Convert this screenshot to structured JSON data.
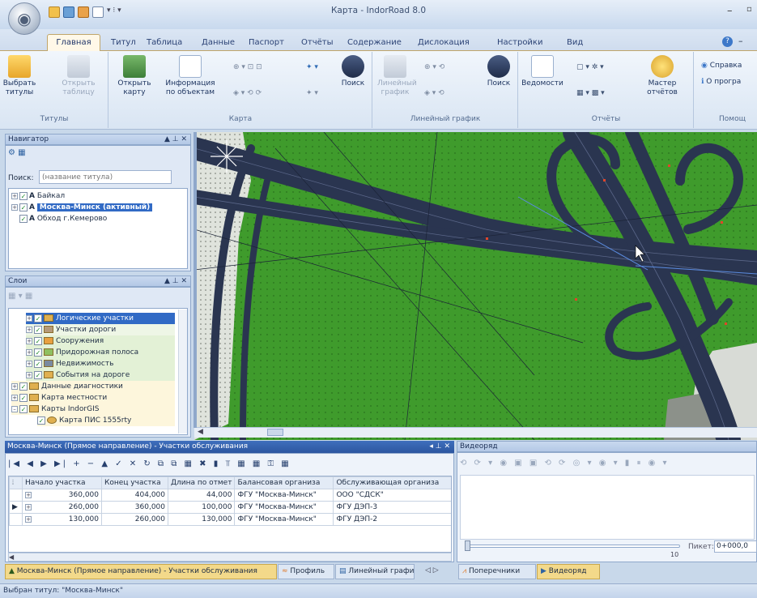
{
  "window": {
    "title": "Карта - IndorRoad 8.0"
  },
  "tabs": [
    "Главная",
    "Титул",
    "Таблица",
    "Данные",
    "Паспорт",
    "Отчёты",
    "Содержание",
    "Дислокация",
    "Настройки",
    "Вид"
  ],
  "ribbon": {
    "groups": {
      "titles": "Титулы",
      "map": "Карта",
      "linear": "Линейный график",
      "reports": "Отчёты",
      "help": "Помощ"
    },
    "select_titles": "Выбрать титулы",
    "open_table": "Открыть таблицу",
    "open_map": "Открыть карту",
    "object_info": "Информация по объектам",
    "search": "Поиск",
    "linear_graph": "Линейный график",
    "search2": "Поиск",
    "statements": "Ведомости",
    "report_master": "Мастер отчётов",
    "help_ref": "Справка",
    "about": "О програ"
  },
  "navigator": {
    "title": "Навигатор",
    "search_label": "Поиск:",
    "search_placeholder": "(название титула)",
    "items": [
      "Байкал",
      "Москва-Минск (активный)",
      "Обход г.Кемерово"
    ]
  },
  "layers": {
    "title": "Слои",
    "items": [
      "Логические участки",
      "Участки дороги",
      "Сооружения",
      "Придорожная полоса",
      "Недвижимость",
      "События на дороге",
      "Данные диагностики",
      "Карта местности",
      "Карты IndorGIS",
      "Карта ПИС 1555rty"
    ]
  },
  "grid": {
    "title": "Москва-Минск (Прямое направление) - Участки обслуживания",
    "columns": [
      "Начало участка",
      "Конец участка",
      "Длина по отмет",
      "Балансовая организа",
      "Обслуживающая организа"
    ],
    "rows": [
      [
        "360,000",
        "404,000",
        "44,000",
        "ФГУ \"Москва-Минск\"",
        "ООО \"СДСК\""
      ],
      [
        "260,000",
        "360,000",
        "100,000",
        "ФГУ \"Москва-Минск\"",
        "ФГУ ДЭП-3"
      ],
      [
        "130,000",
        "260,000",
        "130,000",
        "ФГУ \"Москва-Минск\"",
        "ФГУ ДЭП-2"
      ]
    ]
  },
  "video": {
    "title": "Видеоряд",
    "picket_label": "Пикет:",
    "picket_value": "0+000,0",
    "slider_max": "10"
  },
  "bottom_tabs_left": [
    "Москва-Минск (Прямое направление) - Участки обслуживания",
    "Профиль",
    "Линейный графи"
  ],
  "bottom_tabs_right": [
    "Поперечники",
    "Видеоряд"
  ],
  "status": "Выбран титул: \"Москва-Минск\"",
  "colors": {
    "accent": "#316ac5",
    "map_green": "#3f9b2c",
    "road": "#2a3550",
    "selection": "#316ac5"
  }
}
